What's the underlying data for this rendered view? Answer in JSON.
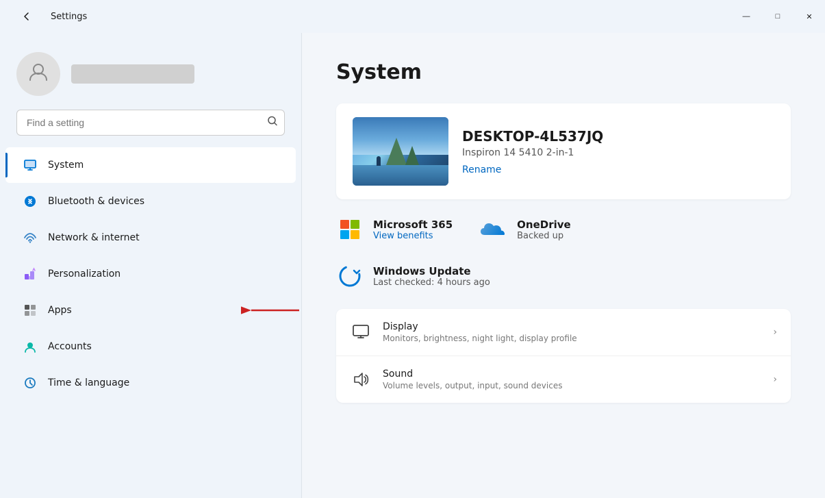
{
  "titlebar": {
    "title": "Settings",
    "minimize_label": "—",
    "maximize_label": "□",
    "close_label": "✕"
  },
  "sidebar": {
    "search_placeholder": "Find a setting",
    "user_name": "",
    "nav_items": [
      {
        "id": "system",
        "label": "System",
        "active": true
      },
      {
        "id": "bluetooth",
        "label": "Bluetooth & devices"
      },
      {
        "id": "network",
        "label": "Network & internet"
      },
      {
        "id": "personalization",
        "label": "Personalization"
      },
      {
        "id": "apps",
        "label": "Apps"
      },
      {
        "id": "accounts",
        "label": "Accounts"
      },
      {
        "id": "timelanguage",
        "label": "Time & language"
      }
    ]
  },
  "main": {
    "page_title": "System",
    "device": {
      "name": "DESKTOP-4L537JQ",
      "model": "Inspiron 14 5410 2-in-1",
      "rename_label": "Rename"
    },
    "services": [
      {
        "id": "ms365",
        "name": "Microsoft 365",
        "status": "View benefits"
      },
      {
        "id": "onedrive",
        "name": "OneDrive",
        "status": "Backed up"
      }
    ],
    "windows_update": {
      "name": "Windows Update",
      "status": "Last checked: 4 hours ago"
    },
    "settings_items": [
      {
        "id": "display",
        "title": "Display",
        "description": "Monitors, brightness, night light, display profile"
      },
      {
        "id": "sound",
        "title": "Sound",
        "description": "Volume levels, output, input, sound devices"
      }
    ]
  }
}
